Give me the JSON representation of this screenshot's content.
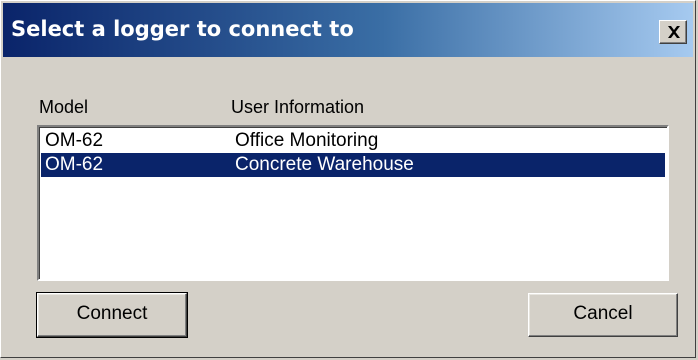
{
  "dialog": {
    "title": "Select a logger to connect to",
    "close_icon": "close-x-icon"
  },
  "list": {
    "columns": [
      "Model",
      "User Information"
    ],
    "rows": [
      {
        "model": "OM-62",
        "user_info": "Office Monitoring",
        "selected": false
      },
      {
        "model": "OM-62",
        "user_info": "Concrete Warehouse",
        "selected": true
      }
    ]
  },
  "buttons": {
    "connect_label": "Connect",
    "cancel_label": "Cancel"
  },
  "colors": {
    "title_start": "#0a246a",
    "title_end": "#a6caf0",
    "selection": "#0a246a",
    "face": "#d4d0c8"
  }
}
